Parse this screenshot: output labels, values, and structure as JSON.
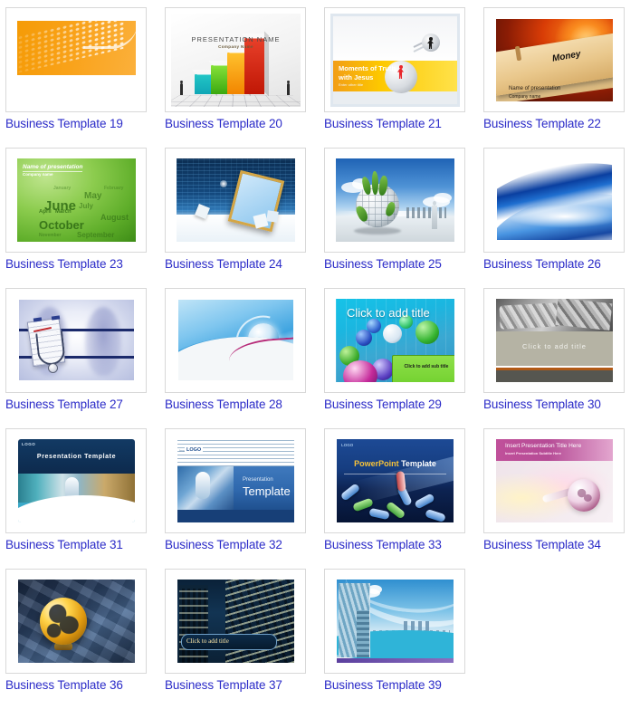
{
  "page": {
    "background_color": "#ffffff",
    "link_color": "#2b2bc8",
    "columns": 4
  },
  "templates": [
    {
      "id": "t19",
      "caption": "Business Template 19",
      "slide": {
        "style": "orange-halftone-banner",
        "texts": []
      }
    },
    {
      "id": "t20",
      "caption": "Business Template 20",
      "slide": {
        "style": "3d-bar-chart",
        "title": "PRESENTATION  NAME",
        "subtitle": "Company Name",
        "bars": [
          "teal",
          "green",
          "orange",
          "red"
        ]
      }
    },
    {
      "id": "t21",
      "caption": "Business Template 21",
      "slide": {
        "style": "yellow-band-sphere",
        "title_line1": "Moments of Truth",
        "title_line2": "with Jesus",
        "subtitle": "Enter other title"
      }
    },
    {
      "id": "t22",
      "caption": "Business Template 22",
      "slide": {
        "style": "money-folder",
        "label": "Money",
        "title": "Name of presentation",
        "subtitle": "Company name"
      }
    },
    {
      "id": "t23",
      "caption": "Business Template 23",
      "slide": {
        "style": "green-calendar-words",
        "title": "Name of presentation",
        "subtitle": "Company name",
        "words": [
          "June",
          "May",
          "July",
          "October",
          "August",
          "March",
          "April",
          "September",
          "November",
          "January",
          "February"
        ]
      }
    },
    {
      "id": "t24",
      "caption": "Business Template 24",
      "slide": {
        "style": "blue-tech-frame",
        "texts": []
      }
    },
    {
      "id": "t25",
      "caption": "Business Template 25",
      "slide": {
        "style": "green-globe-city",
        "texts": []
      }
    },
    {
      "id": "t26",
      "caption": "Business Template 26",
      "slide": {
        "style": "blue-swirl",
        "texts": []
      }
    },
    {
      "id": "t27",
      "caption": "Business Template 27",
      "slide": {
        "style": "medical-xray-stethoscope",
        "texts": []
      }
    },
    {
      "id": "t28",
      "caption": "Business Template 28",
      "slide": {
        "style": "blue-sphere-wave",
        "texts": []
      }
    },
    {
      "id": "t29",
      "caption": "Business Template 29",
      "slide": {
        "style": "marbles",
        "title": "Click to add title",
        "subtitle": "Click to add sub title"
      }
    },
    {
      "id": "t30",
      "caption": "Business Template 30",
      "slide": {
        "style": "grey-pipes",
        "title": "Click  to  add  title"
      }
    },
    {
      "id": "t31",
      "caption": "Business Template 31",
      "slide": {
        "style": "dark-blue-header-photo",
        "logo": "LOGO",
        "title": "Presentation  Template"
      }
    },
    {
      "id": "t32",
      "caption": "Business Template 32",
      "slide": {
        "style": "lines-logo-blue",
        "logo_prefix": "Insert",
        "logo": "LOGO",
        "title_line1": "Presentation",
        "title_line2": "Template"
      }
    },
    {
      "id": "t33",
      "caption": "Business Template 33",
      "slide": {
        "style": "blue-chain-links",
        "logo": "LOGO",
        "title_accent": "PowerPoint",
        "title_rest": " Template"
      }
    },
    {
      "id": "t34",
      "caption": "Business Template 34",
      "slide": {
        "style": "pink-globe",
        "title": "Insert Presentation Title Here",
        "subtitle": "Insert Presentation Subtitle Here"
      }
    },
    {
      "id": "t36",
      "caption": "Business Template 36",
      "slide": {
        "style": "gold-globe-panels",
        "texts": []
      }
    },
    {
      "id": "t37",
      "caption": "Business Template 37",
      "slide": {
        "style": "night-city",
        "title": "Click  to  add  title"
      }
    },
    {
      "id": "t39",
      "caption": "Business Template 39",
      "slide": {
        "style": "blue-city-skyline",
        "texts": []
      }
    }
  ]
}
